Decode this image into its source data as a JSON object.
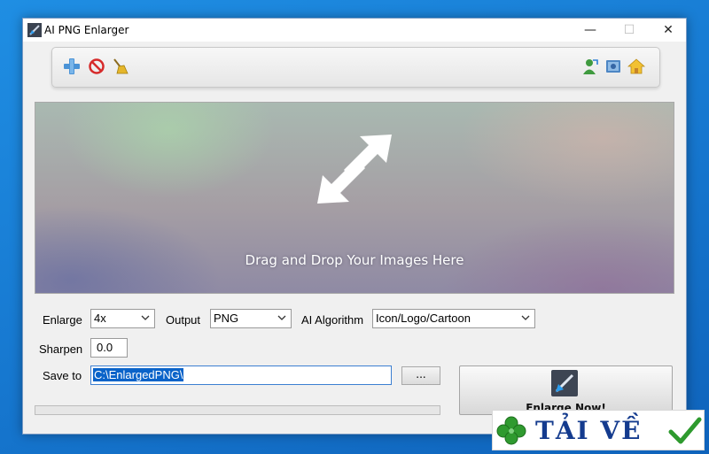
{
  "window": {
    "title": "AI PNG Enlarger"
  },
  "window_controls": {
    "minimize": "—",
    "maximize": "☐",
    "close": "✕"
  },
  "toolbar": {
    "left_icons": [
      "add-icon",
      "remove-icon",
      "clear-broom-icon"
    ],
    "right_icons": [
      "user-icon",
      "help-book-icon",
      "home-icon"
    ]
  },
  "dropzone": {
    "text": "Drag and Drop Your Images Here",
    "icon": "resize-arrow-icon"
  },
  "settings": {
    "enlarge_label": "Enlarge",
    "enlarge_value": "4x",
    "output_label": "Output",
    "output_value": "PNG",
    "algorithm_label": "AI Algorithm",
    "algorithm_value": "Icon/Logo/Cartoon",
    "sharpen_label": "Sharpen",
    "sharpen_value": "0.0",
    "save_label": "Save to",
    "save_value": "C:\\EnlargedPNG\\",
    "browse_label": "..."
  },
  "progress": {
    "value": 0
  },
  "enlarge_button": {
    "label": "Enlarge Now!"
  },
  "watermark": {
    "text": "TẢI VỀ"
  }
}
